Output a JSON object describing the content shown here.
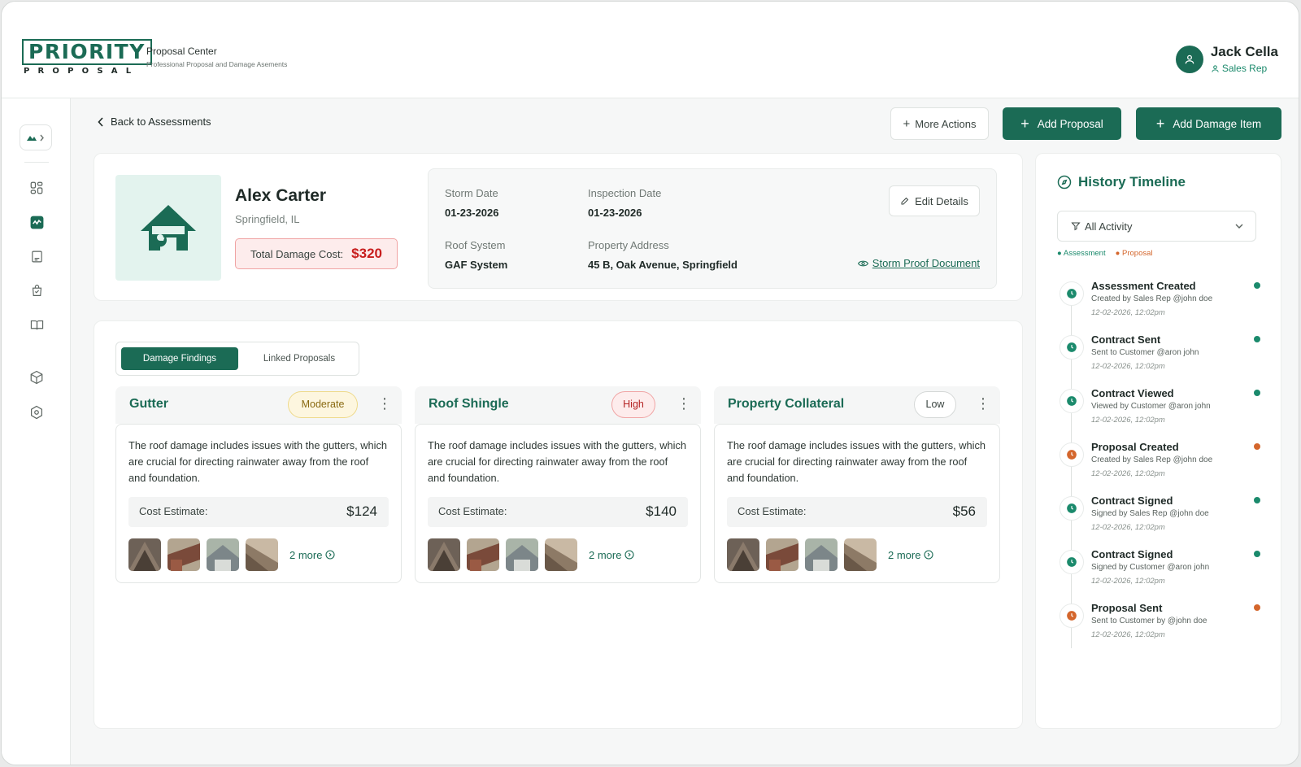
{
  "brand": {
    "logo_top": "PRIORITY",
    "logo_bottom": "PROPOSAL",
    "title": "Proposal Center",
    "subtitle": "Professional Proposal and Damage Asements"
  },
  "user": {
    "name": "Jack Cella",
    "role": "Sales Rep"
  },
  "sidebar": {
    "items": [
      "dashboard-icon",
      "activity-icon",
      "document-icon",
      "bag-icon",
      "book-icon",
      "package-icon",
      "settings-icon"
    ],
    "active_index": 1
  },
  "toolbar": {
    "back_label": "Back to Assessments",
    "more_actions_label": "More Actions",
    "add_proposal_label": "Add Proposal",
    "add_damage_label": "Add Damage Item"
  },
  "client": {
    "name": "Alex Carter",
    "location": "Springfield, IL",
    "damage_cost_label": "Total Damage Cost:",
    "damage_cost_value": "$320"
  },
  "details": {
    "storm_date_label": "Storm Date",
    "storm_date": "01-23-2026",
    "inspection_date_label": "Inspection Date",
    "inspection_date": "01-23-2026",
    "roof_system_label": "Roof System",
    "roof_system": "GAF System",
    "address_label": "Property Address",
    "address": "45 B, Oak Avenue, Springfield",
    "edit_label": "Edit Details",
    "storm_doc_label": "Storm Proof Document"
  },
  "tabs": [
    {
      "label": "Damage Findings",
      "active": true
    },
    {
      "label": "Linked  Proposals",
      "active": false
    }
  ],
  "damage_cards": [
    {
      "title": "Gutter",
      "severity": "Moderate",
      "severity_bg": "#fdf6df",
      "severity_border": "#eed98a",
      "severity_color": "#8a6a12",
      "description": "The roof damage includes issues with the gutters, which are crucial for directing rainwater away from the roof and foundation.",
      "cost_label": "Cost Estimate:",
      "cost": "$124",
      "more_label": "2 more"
    },
    {
      "title": "Roof Shingle",
      "severity": "High",
      "severity_bg": "#fdecec",
      "severity_border": "#f0a4a4",
      "severity_color": "#b42323",
      "description": "The roof damage includes issues with the gutters, which are crucial for directing rainwater away from the roof and foundation.",
      "cost_label": "Cost Estimate:",
      "cost": "$140",
      "more_label": "2 more"
    },
    {
      "title": "Property Collateral",
      "severity": "Low",
      "severity_bg": "#ffffff",
      "severity_border": "#d5d8d7",
      "severity_color": "#3a4440",
      "description": "The roof damage includes issues with the gutters, which are crucial for directing rainwater away from the roof and foundation.",
      "cost_label": "Cost Estimate:",
      "cost": "$56",
      "more_label": "2 more"
    }
  ],
  "timeline": {
    "title": "History Timeline",
    "filter_label": "All Activity",
    "legend_assessment": "Assessment",
    "legend_proposal": "Proposal",
    "events": [
      {
        "name": "Assessment Created",
        "by": "Created by Sales Rep @john doe",
        "time": "12-02-2026, 12:02pm",
        "kind": "assessment"
      },
      {
        "name": "Contract Sent",
        "by": "Sent to Customer @aron john",
        "time": "12-02-2026, 12:02pm",
        "kind": "assessment"
      },
      {
        "name": "Contract Viewed",
        "by": "Viewed by Customer @aron john",
        "time": "12-02-2026, 12:02pm",
        "kind": "assessment"
      },
      {
        "name": "Proposal Created",
        "by": "Created by Sales Rep @john doe",
        "time": "12-02-2026, 12:02pm",
        "kind": "proposal"
      },
      {
        "name": "Contract Signed",
        "by": "Signed by Sales Rep @john doe",
        "time": "12-02-2026, 12:02pm",
        "kind": "assessment"
      },
      {
        "name": "Contract Signed",
        "by": "Signed by Customer @aron john",
        "time": "12-02-2026, 12:02pm",
        "kind": "assessment"
      },
      {
        "name": "Proposal Sent",
        "by": "Sent to Customer by @john doe",
        "time": "12-02-2026, 12:02pm",
        "kind": "proposal"
      }
    ]
  },
  "colors": {
    "brand": "#1b6b55",
    "assessment": "#1b8a6c",
    "proposal": "#d4662c",
    "danger": "#c81e1e"
  }
}
